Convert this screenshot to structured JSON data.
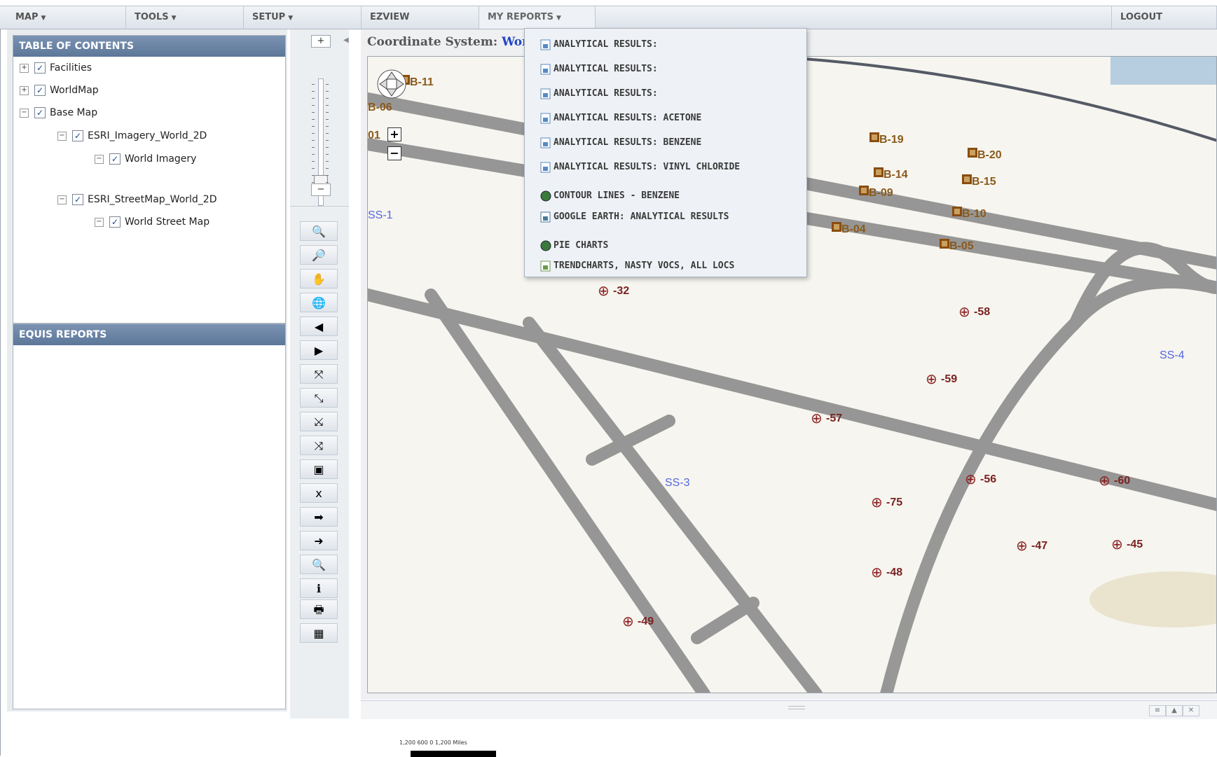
{
  "menubar": {
    "items": [
      {
        "label": "MAP"
      },
      {
        "label": "TOOLS"
      },
      {
        "label": "SETUP"
      },
      {
        "label": "EZVIEW"
      },
      {
        "label": "MY REPORTS"
      }
    ],
    "logout": "LOGOUT"
  },
  "toc": {
    "title": "TABLE OF CONTENTS",
    "layers": [
      {
        "label": "Facilities",
        "expander": "+",
        "checked": true
      },
      {
        "label": "WorldMap",
        "expander": "+",
        "checked": true
      },
      {
        "label": "Base Map",
        "expander": "−",
        "checked": true
      },
      {
        "label": "ESRI_Imagery_World_2D",
        "expander": "−",
        "checked": true
      },
      {
        "label": "World Imagery",
        "expander": "−",
        "checked": true
      },
      {
        "label": "ESRI_StreetMap_World_2D",
        "expander": "−",
        "checked": true
      },
      {
        "label": "World Street Map",
        "expander": "−",
        "checked": true
      }
    ]
  },
  "reports_panel": {
    "title": "EQUIS REPORTS"
  },
  "zoom": {
    "plus": "+",
    "minus": "−",
    "level_fraction": 0.15
  },
  "tools": [
    {
      "name": "zoom-in-icon",
      "glyph": "🔍"
    },
    {
      "name": "zoom-out-icon",
      "glyph": "🔎"
    },
    {
      "name": "pan-hand-icon",
      "glyph": "✋"
    },
    {
      "name": "full-extent-globe-icon",
      "glyph": "🌐"
    },
    {
      "name": "back-arrow-icon",
      "glyph": "◀"
    },
    {
      "name": "forward-arrow-icon",
      "glyph": "▶"
    },
    {
      "name": "zoom-in-fixed-icon",
      "glyph": "⤧"
    },
    {
      "name": "zoom-out-fixed-icon",
      "glyph": "⤡"
    },
    {
      "name": "select-box-icon",
      "glyph": "⤩"
    },
    {
      "name": "clear-selection-icon",
      "glyph": "⤨"
    },
    {
      "name": "identify-frame-icon",
      "glyph": "▣"
    },
    {
      "name": "measure-xy-icon",
      "glyph": "x"
    },
    {
      "name": "export-arrow-icon",
      "glyph": "➡"
    },
    {
      "name": "goto-xy-icon",
      "glyph": "➜"
    },
    {
      "name": "search-icon",
      "glyph": "🔍"
    },
    {
      "name": "info-icon",
      "glyph": "ℹ"
    },
    {
      "name": "print-icon",
      "glyph": "🖶"
    },
    {
      "name": "color-ramp-icon",
      "glyph": "▦"
    }
  ],
  "map": {
    "coordinate_label": "Coordinate System:",
    "coordinate_value": "Worl",
    "labels": [
      {
        "text": "B-11",
        "kind": "brn"
      },
      {
        "text": "B-06",
        "kind": "brn"
      },
      {
        "text": "01",
        "kind": "brn"
      },
      {
        "text": "B-19",
        "kind": "brn"
      },
      {
        "text": "B-20",
        "kind": "brn"
      },
      {
        "text": "B-14",
        "kind": "brn"
      },
      {
        "text": "B-15",
        "kind": "brn"
      },
      {
        "text": "B-09",
        "kind": "brn"
      },
      {
        "text": "B-10",
        "kind": "brn"
      },
      {
        "text": "B-04",
        "kind": "brn"
      },
      {
        "text": "B-05",
        "kind": "brn"
      },
      {
        "text": "SS-1",
        "kind": "blue"
      },
      {
        "text": "SS-4",
        "kind": "blue"
      },
      {
        "text": "SS-3",
        "kind": "blue"
      },
      {
        "text": "-32",
        "kind": "red"
      },
      {
        "text": "-58",
        "kind": "red"
      },
      {
        "text": "-59",
        "kind": "red"
      },
      {
        "text": "-57",
        "kind": "red"
      },
      {
        "text": "-56",
        "kind": "red"
      },
      {
        "text": "-60",
        "kind": "red"
      },
      {
        "text": "-75",
        "kind": "red"
      },
      {
        "text": "-47",
        "kind": "red"
      },
      {
        "text": "-45",
        "kind": "red"
      },
      {
        "text": "-48",
        "kind": "red"
      },
      {
        "text": "-49",
        "kind": "red"
      }
    ]
  },
  "my_reports_menu": {
    "items": [
      "ANALYTICAL RESULTS:",
      "ANALYTICAL RESULTS:",
      "ANALYTICAL RESULTS:",
      "ANALYTICAL RESULTS: ACETONE",
      "ANALYTICAL RESULTS: BENZENE",
      "ANALYTICAL RESULTS: VINYL CHLORIDE",
      "CONTOUR LINES - BENZENE",
      "GOOGLE EARTH: ANALYTICAL RESULTS",
      "PIE CHARTS",
      "TRENDCHARTS, NASTY VOCS, ALL LOCS"
    ]
  },
  "scale": {
    "ticks": "1,200  600    0           1,200 Miles"
  },
  "colors": {
    "header": "#5d7799",
    "link_blue": "#2044c4",
    "marker_red": "#8a1f1f",
    "marker_brown": "#8a4d10"
  }
}
